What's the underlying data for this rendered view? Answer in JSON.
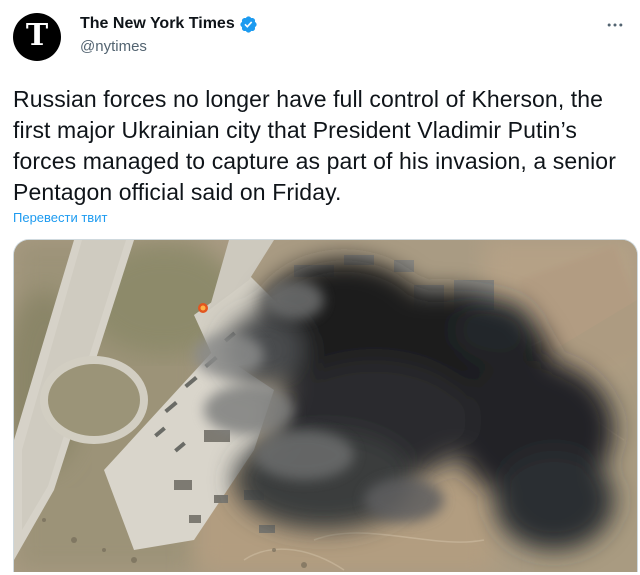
{
  "tweet": {
    "author": {
      "display_name": "The New York Times",
      "handle": "@nytimes",
      "avatar_glyph": "T",
      "verified": true
    },
    "text": "Russian forces no longer have full control of Kherson, the first major Ukrainian city that President Vladimir Putin’s forces managed to capture as part of his invasion, a senior Pentagon official said on Friday.",
    "translate_label": "Перевести твит",
    "media": {
      "description_icon": "satellite-photo"
    }
  },
  "colors": {
    "link": "#1d9bf0",
    "verified": "#1d9bf0",
    "secondary_text": "#536471",
    "primary_text": "#0f1419"
  },
  "icons": {
    "verified": "verified-badge-icon",
    "more": "more-options-icon"
  }
}
